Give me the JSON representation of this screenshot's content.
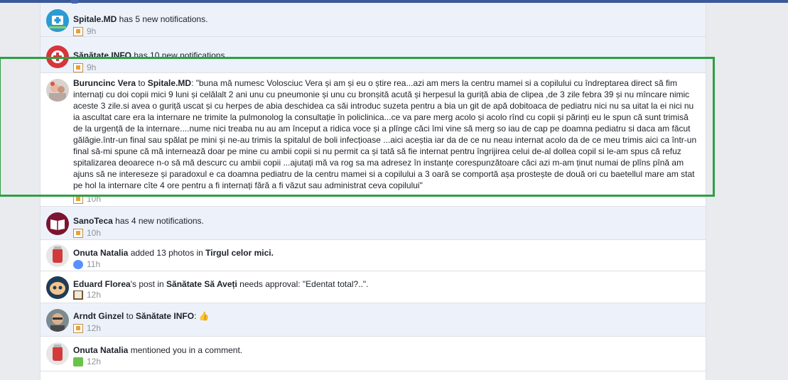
{
  "notifications": [
    {
      "actor": "Spitale.MD",
      "text": " has 5 new notifications.",
      "time": "9h",
      "icon": "flag-icon"
    },
    {
      "actor": "Sănătate INFO",
      "text": " has 10 new notifications.",
      "time": "9h",
      "icon": "flag-icon"
    },
    {
      "actor": "Buruncinc Vera",
      "connector": " to ",
      "target": "Spitale.MD",
      "text": ": \"buna mă numesc Volosciuc Vera și am și eu o știre rea...azi am mers la centru mamei si a copilului cu îndreptarea direct să fim internați cu doi copii mici 9 luni și celălalt 2 ani unu cu pneumonie și unu cu bronșită acută și herpesul la guriță abia de clipea ,de 3 zile febra 39 și nu mîncare nimic aceste 3 zile.si avea o guriță uscat și cu herpes de abia deschidea ca săi introduc suzeta pentru a bia un git de apă dobitoaca de pediatru nici nu sa uitat la ei nici nu ia ascultat care era la internare ne trimite la pulmonolog la consultație în policlinica...ce va pare merg acolo și acolo rînd cu copii și părinți eu le spun că sunt trimisă de la urgență de la internare....nume nici treaba nu au am început a ridica voce și a plînge căci îmi vine să merg so iau de cap pe doamna pediatru si daca am făcut gălăgie.într-un final sau spălat pe mini și ne-au trimis la spitalul de boli infecțioase ...aici aceștia iar da de ce nu neau internat acolo da de ce meu trimis aici ca într-un final să-mi spune că mă internează doar pe mine cu ambii copii si nu permit ca și tată să fie internat pentru îngrijirea celui de-al dollea copil si le-am spus că refuz spitalizarea deoarece n-o să mă descurc cu ambii copii ...ajutați mă va rog sa ma adresez în instanțe corespunzătoare căci azi m-am ținut numai de plîns pînă am ajuns să ne intereseze și paradoxul e ca doamna pediatru de la centru mamei si a copilului a 3 oară se comportă așa prostește de două ori cu baetellul mare am stat pe hol la internare cîte 4 ore pentru a fi internați fără a fi văzut sau administrat ceva copilului\"",
      "time": "10h",
      "icon": "flag-icon"
    },
    {
      "actor": "SanoTeca",
      "text": " has 4 new notifications.",
      "time": "10h",
      "icon": "flag-icon"
    },
    {
      "actor": "Onuta Natalia",
      "text": " added 13 photos in ",
      "target": "Tirgul celor mici.",
      "suffix": ".",
      "time": "11h",
      "icon": "photos-icon"
    },
    {
      "actor": "Eduard Florea",
      "text": "'s post in ",
      "target": "Sănătate Să Aveți",
      "suffix": " needs approval: \"Edentat total?..\".",
      "time": "12h",
      "icon": "book-icon"
    },
    {
      "actor": "Arndt Ginzel",
      "connector": " to ",
      "target": "Sănătate INFO",
      "suffix": ": 👍",
      "time": "12h",
      "icon": "flag-icon"
    },
    {
      "actor": "Onuta Natalia",
      "text": " mentioned you in a comment.",
      "time": "12h",
      "icon": "comment-icon"
    }
  ],
  "colors": {
    "background": "#e9ebee",
    "highlight_border": "#2e9f45",
    "unread_row": "#edf2fa",
    "meta_text": "#90949c"
  }
}
